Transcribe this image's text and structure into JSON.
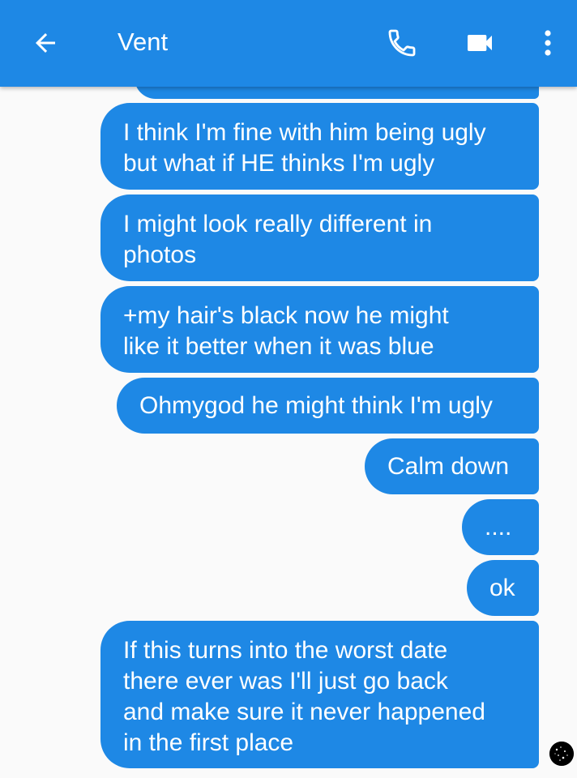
{
  "header": {
    "title": "Vent",
    "back_icon": "arrow-back-icon",
    "call_icon": "phone-icon",
    "video_icon": "videocam-icon",
    "more_icon": "more-vert-icon"
  },
  "colors": {
    "app_bar": "#1e88e5",
    "bubble": "#1e88e5",
    "background": "#fafafa",
    "text_on_bubble": "#ffffff"
  },
  "messages": [
    {
      "text": "I think I'm fine with him being ugly\nbut what if HE thinks I'm ugly"
    },
    {
      "text": "I might look really different in\nphotos"
    },
    {
      "text": "+my hair's black now he might\nlike it better when it was blue"
    },
    {
      "text": "Ohmygod he might think I'm ugly"
    },
    {
      "text": "Calm down"
    },
    {
      "text": "...."
    },
    {
      "text": "ok"
    },
    {
      "text": "If this turns into the worst date\nthere ever was I'll just go back\nand make sure it never happened\nin the first place"
    }
  ]
}
